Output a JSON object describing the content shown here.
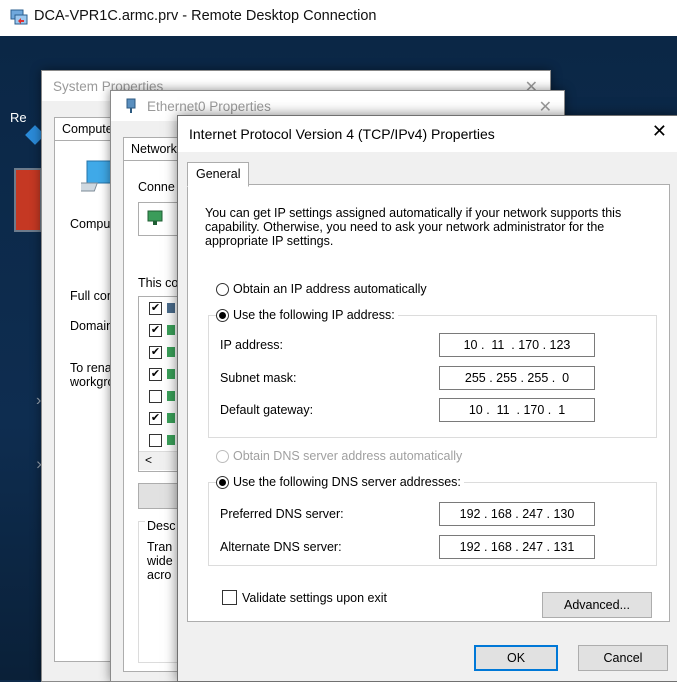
{
  "rdp": {
    "title": "DCA-VPR1C.armc.prv - Remote Desktop Connection"
  },
  "desktop": {
    "partial_label": "Re"
  },
  "system_properties": {
    "title": "System Properties",
    "tab": "Compute",
    "rows": [
      "Comput",
      "Full com",
      "Domain",
      "To rena",
      "workgro"
    ]
  },
  "ethernet_properties": {
    "title": "Ethernet0 Properties",
    "tab": "Network",
    "connect_label": "Conne",
    "this_label": "This co",
    "desc_label": "Desc",
    "desc_lines": [
      "Tran",
      "wide",
      "acro"
    ],
    "items": [
      {
        "checked": true
      },
      {
        "checked": true
      },
      {
        "checked": true
      },
      {
        "checked": true
      },
      {
        "checked": false
      },
      {
        "checked": true
      },
      {
        "checked": false
      }
    ],
    "scroll_left": "<"
  },
  "tcp": {
    "title": "Internet Protocol Version 4 (TCP/IPv4) Properties",
    "tab": "General",
    "description": "You can get IP settings assigned automatically if your network supports this capability. Otherwise, you need to ask your network administrator for the appropriate IP settings.",
    "obtain_ip": "Obtain an IP address automatically",
    "use_ip": "Use the following IP address:",
    "ip_label": "IP address:",
    "ip_value": "10 .  11  . 170 . 123",
    "subnet_label": "Subnet mask:",
    "subnet_value": "255 . 255 . 255 .  0",
    "gateway_label": "Default gateway:",
    "gateway_value": "10 .  11  . 170 .  1",
    "obtain_dns": "Obtain DNS server address automatically",
    "use_dns": "Use the following DNS server addresses:",
    "pref_dns_label": "Preferred DNS server:",
    "pref_dns_value": "192 . 168 . 247 . 130",
    "alt_dns_label": "Alternate DNS server:",
    "alt_dns_value": "192 . 168 . 247 . 131",
    "validate": "Validate settings upon exit",
    "advanced": "Advanced...",
    "ok": "OK",
    "cancel": "Cancel",
    "close_glyph": "✕"
  }
}
